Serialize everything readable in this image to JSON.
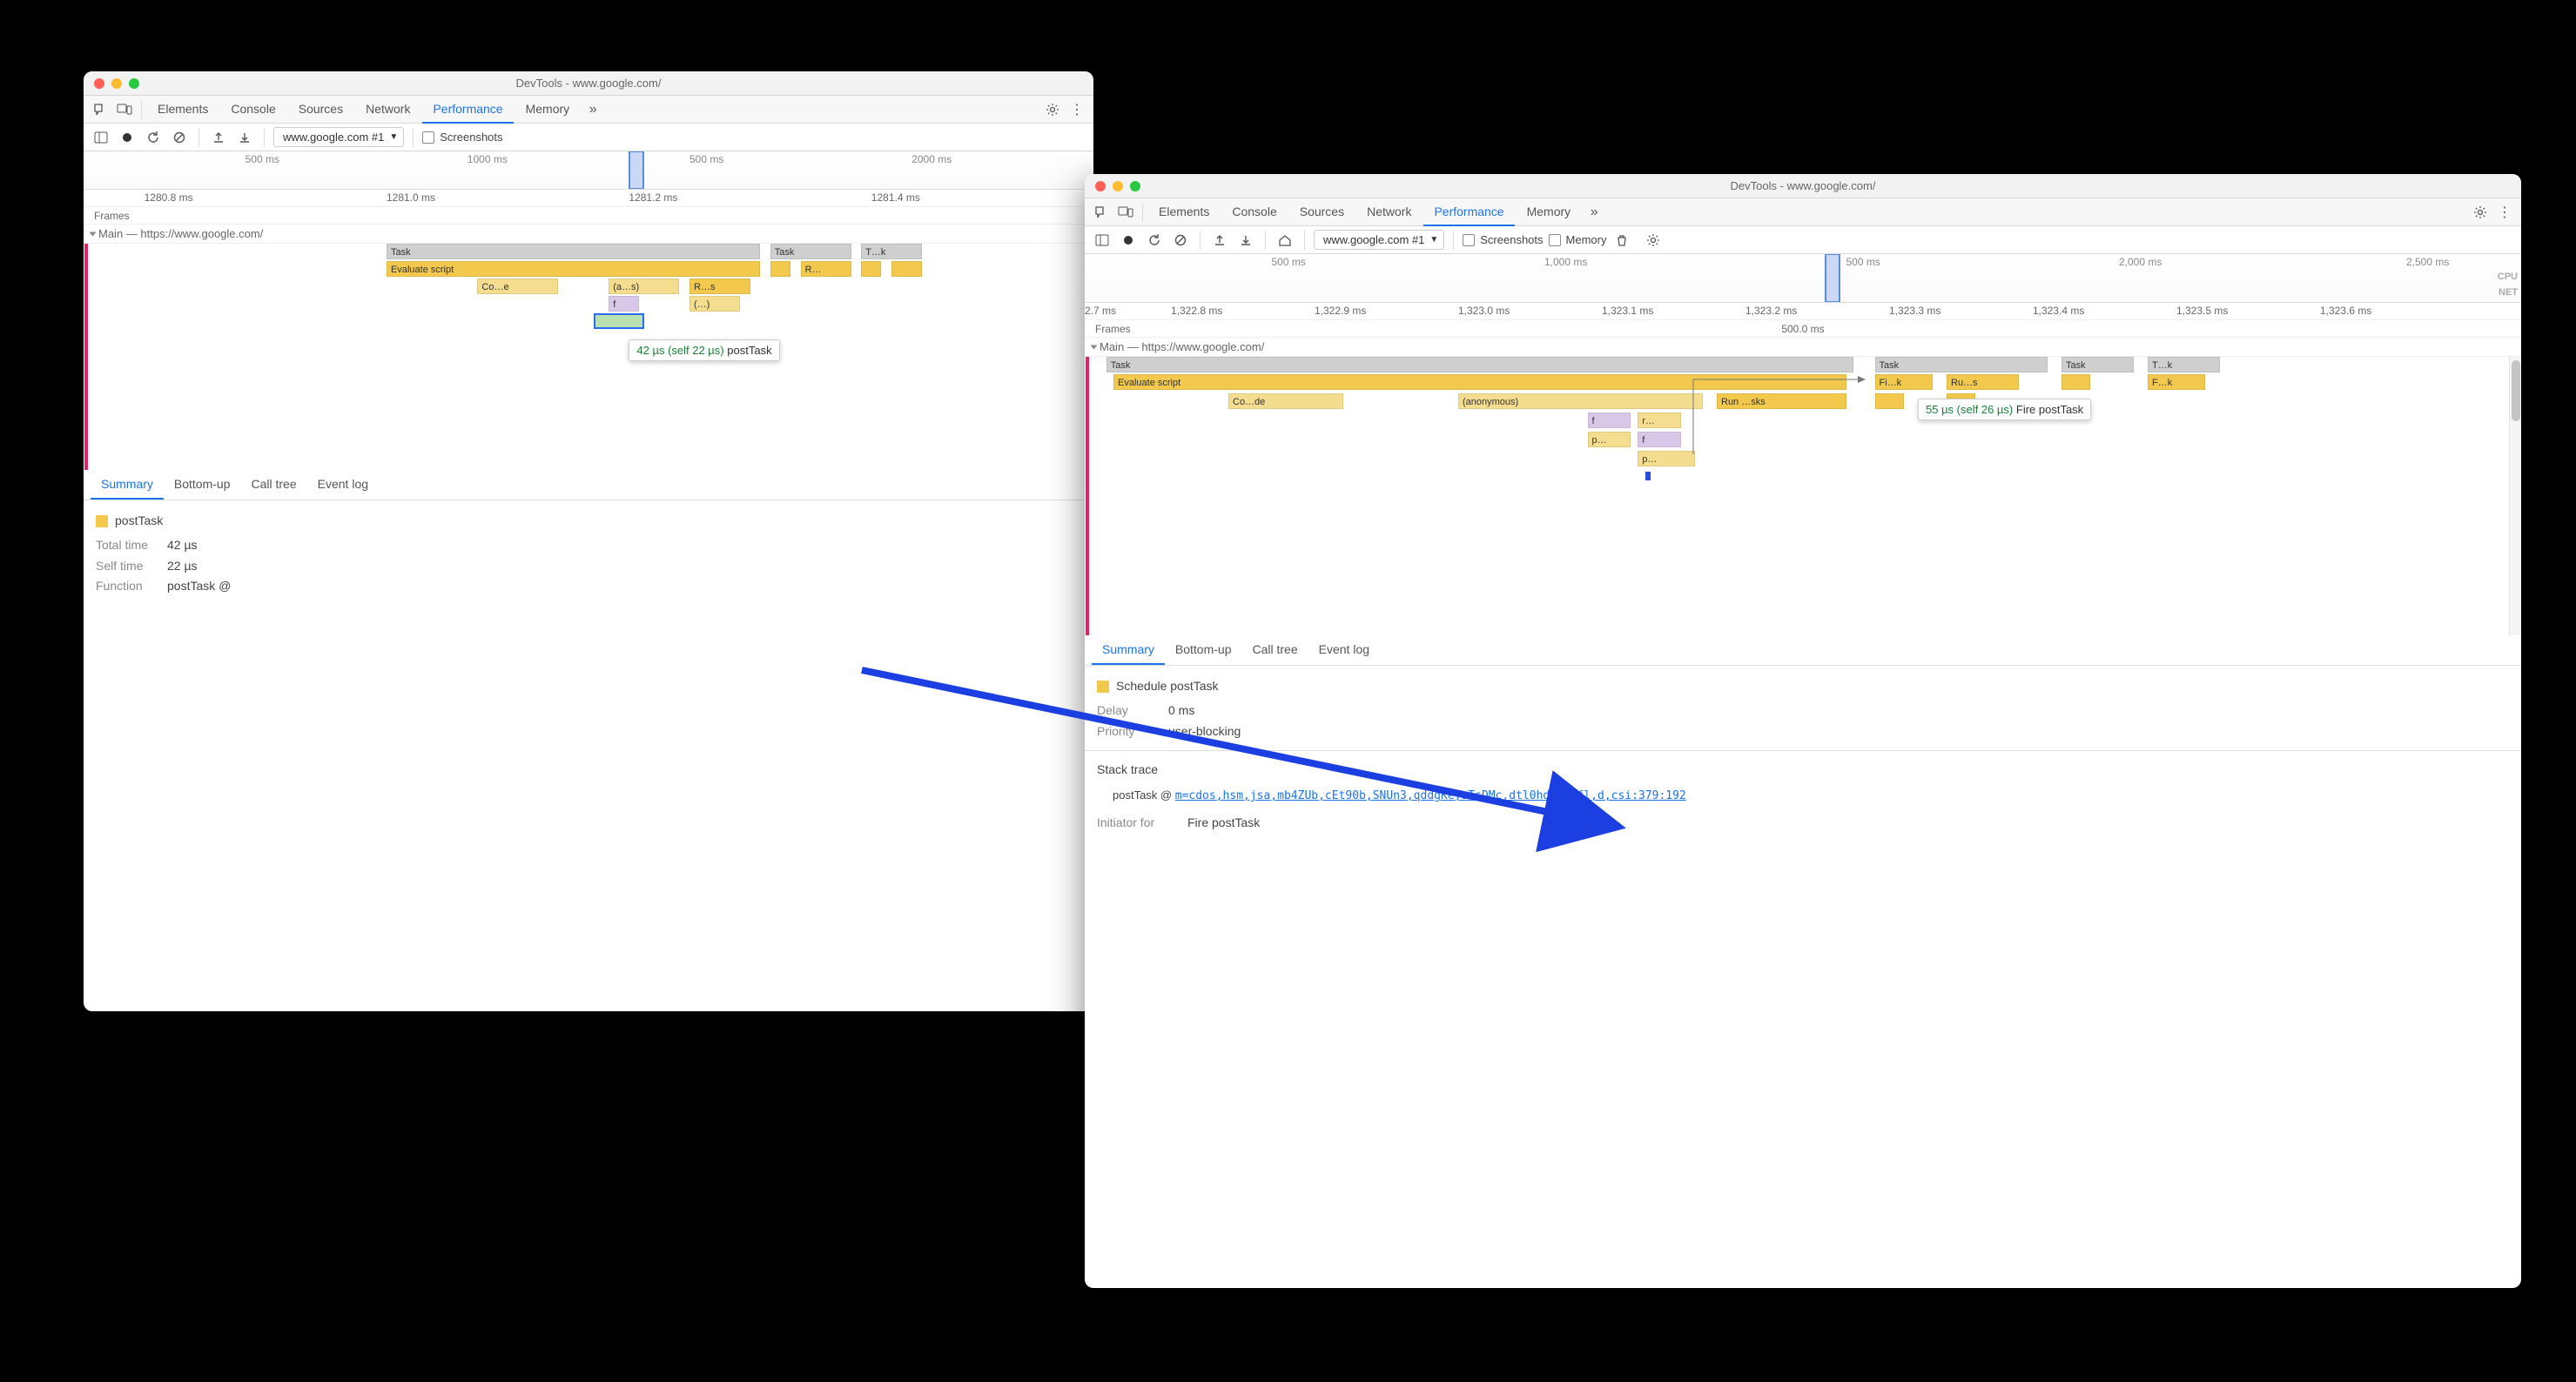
{
  "colors": {
    "accent": "#1a73e8",
    "task_yellow": "#f2c94c"
  },
  "window_a": {
    "title": "DevTools - www.google.com/",
    "tabs": [
      "Elements",
      "Console",
      "Sources",
      "Network",
      "Performance",
      "Memory"
    ],
    "active_tab": "Performance",
    "toolbar": {
      "trace_label": "www.google.com #1",
      "screenshots_label": "Screenshots"
    },
    "overview_ticks": [
      "500 ms",
      "1000 ms",
      "500 ms",
      "2000 ms"
    ],
    "time_ticks": [
      "1280.8 ms",
      "1281.0 ms",
      "1281.2 ms",
      "1281.4 ms"
    ],
    "frames_label": "Frames",
    "main_label": "Main — https://www.google.com/",
    "flame": {
      "task1": "Task",
      "task2": "Task",
      "task3": "T…k",
      "eval": "Evaluate script",
      "co_e": "Co…e",
      "as": "(a…s)",
      "rs": "R…s",
      "f": "f",
      "paren": "(…)",
      "r": "R…"
    },
    "tooltip": {
      "time": "42 µs (self 22 µs)",
      "name": "postTask"
    },
    "bottom_tabs": [
      "Summary",
      "Bottom-up",
      "Call tree",
      "Event log"
    ],
    "summary": {
      "title": "postTask",
      "total_label": "Total time",
      "total_val": "42 µs",
      "self_label": "Self time",
      "self_val": "22 µs",
      "func_label": "Function",
      "func_val": "postTask @"
    }
  },
  "window_b": {
    "title": "DevTools - www.google.com/",
    "tabs": [
      "Elements",
      "Console",
      "Sources",
      "Network",
      "Performance",
      "Memory"
    ],
    "active_tab": "Performance",
    "toolbar": {
      "trace_label": "www.google.com #1",
      "screenshots_label": "Screenshots",
      "memory_label": "Memory"
    },
    "overview_ticks": [
      "500 ms",
      "1,000 ms",
      "500 ms",
      "2,000 ms",
      "2,500 ms"
    ],
    "cpu_label": "CPU",
    "net_label": "NET",
    "time_ticks": [
      "2.7 ms",
      "1,322.8 ms",
      "1,322.9 ms",
      "1,323.0 ms",
      "1,323.1 ms",
      "1,323.2 ms",
      "1,323.3 ms",
      "1,323.4 ms",
      "1,323.5 ms",
      "1,323.6 ms"
    ],
    "frames_label": "Frames",
    "frame_time": "500.0 ms",
    "main_label": "Main — https://www.google.com/",
    "flame": {
      "task1": "Task",
      "task2": "Task",
      "task3": "Task",
      "task4": "T…k",
      "eval": "Evaluate script",
      "code": "Co…de",
      "anon": "(anonymous)",
      "run": "Run …sks",
      "f": "f",
      "r": "r…",
      "p": "p…",
      "f2": "f",
      "p2": "p…",
      "fik": "Fi…k",
      "rus": "Ru…s",
      "fk": "F…k"
    },
    "tooltip": {
      "time": "55 µs (self 26 µs)",
      "name": "Fire postTask"
    },
    "bottom_tabs": [
      "Summary",
      "Bottom-up",
      "Call tree",
      "Event log"
    ],
    "summary": {
      "title": "Schedule postTask",
      "delay_label": "Delay",
      "delay_val": "0 ms",
      "prio_label": "Priority",
      "prio_val": "user-blocking",
      "stack_label": "Stack trace",
      "stack_fn": "postTask @",
      "stack_link": "m=cdos,hsm,jsa,mb4ZUb,cEt90b,SNUn3,qddgKe,sTsDMc,dtl0hd,eHDfl,d,csi:379:192",
      "initiator_label": "Initiator for",
      "initiator_val": "Fire postTask"
    }
  }
}
